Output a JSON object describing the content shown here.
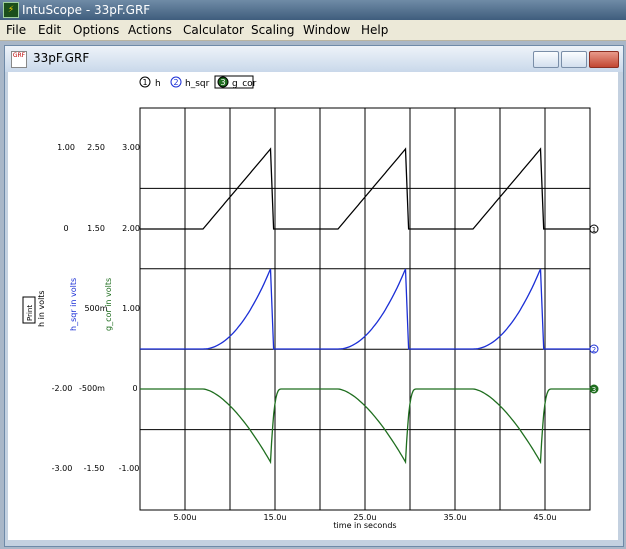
{
  "window": {
    "title": "IntuScope - 33pF.GRF",
    "app_icon": "intuscope-app-icon"
  },
  "menu": [
    "File",
    "Edit",
    "Options",
    "Actions",
    "Calculator",
    "Scaling",
    "Window",
    "Help"
  ],
  "child": {
    "title": "33pF.GRF",
    "icon_label": "GRF"
  },
  "legend": [
    {
      "num": "1",
      "name": "h",
      "color": "#000000"
    },
    {
      "num": "2",
      "name": "h_sqr",
      "color": "#1b2fd6"
    },
    {
      "num": "3",
      "name": "g_cor",
      "color": "#1f6e1f"
    }
  ],
  "axes": {
    "left_box_label": "Print",
    "axis1_label": "h in volts",
    "axis2_label": "h_sqr in volts",
    "axis3_label": "g_cor in volts",
    "col1_ticks": [
      "1.00",
      "0",
      "-2.00",
      "-3.00"
    ],
    "col2_ticks": [
      "2.50",
      "1.50",
      "500m",
      "-500m",
      "-1.50"
    ],
    "col3_ticks": [
      "3.00",
      "2.00",
      "1.00",
      "0",
      "-1.00"
    ],
    "x_ticks": [
      "5.00u",
      "15.0u",
      "25.0u",
      "35.0u",
      "45.0u"
    ],
    "x_label": "time in seconds"
  },
  "chart_data": {
    "type": "line",
    "x_unit": "s",
    "series": [
      {
        "name": "h",
        "color": "#000000",
        "y_range": [
          2.0,
          3.0
        ],
        "shape": "ramp",
        "periods": [
          [
            7.0,
            14.5
          ],
          [
            22.0,
            29.5
          ],
          [
            37.0,
            44.5
          ]
        ]
      },
      {
        "name": "h_sqr",
        "color": "#1b2fd6",
        "y_range": [
          0.5,
          1.5
        ],
        "shape": "quadratic",
        "periods": [
          [
            7.0,
            14.5
          ],
          [
            22.0,
            29.5
          ],
          [
            37.0,
            44.5
          ]
        ]
      },
      {
        "name": "g_cor",
        "color": "#1f6e1f",
        "y_range": [
          -0.9,
          0.0
        ],
        "shape": "dip",
        "periods": [
          [
            7.0,
            14.5
          ],
          [
            22.0,
            29.5
          ],
          [
            37.0,
            44.5
          ]
        ]
      }
    ],
    "xlim": [
      0,
      50
    ],
    "grid": true
  }
}
